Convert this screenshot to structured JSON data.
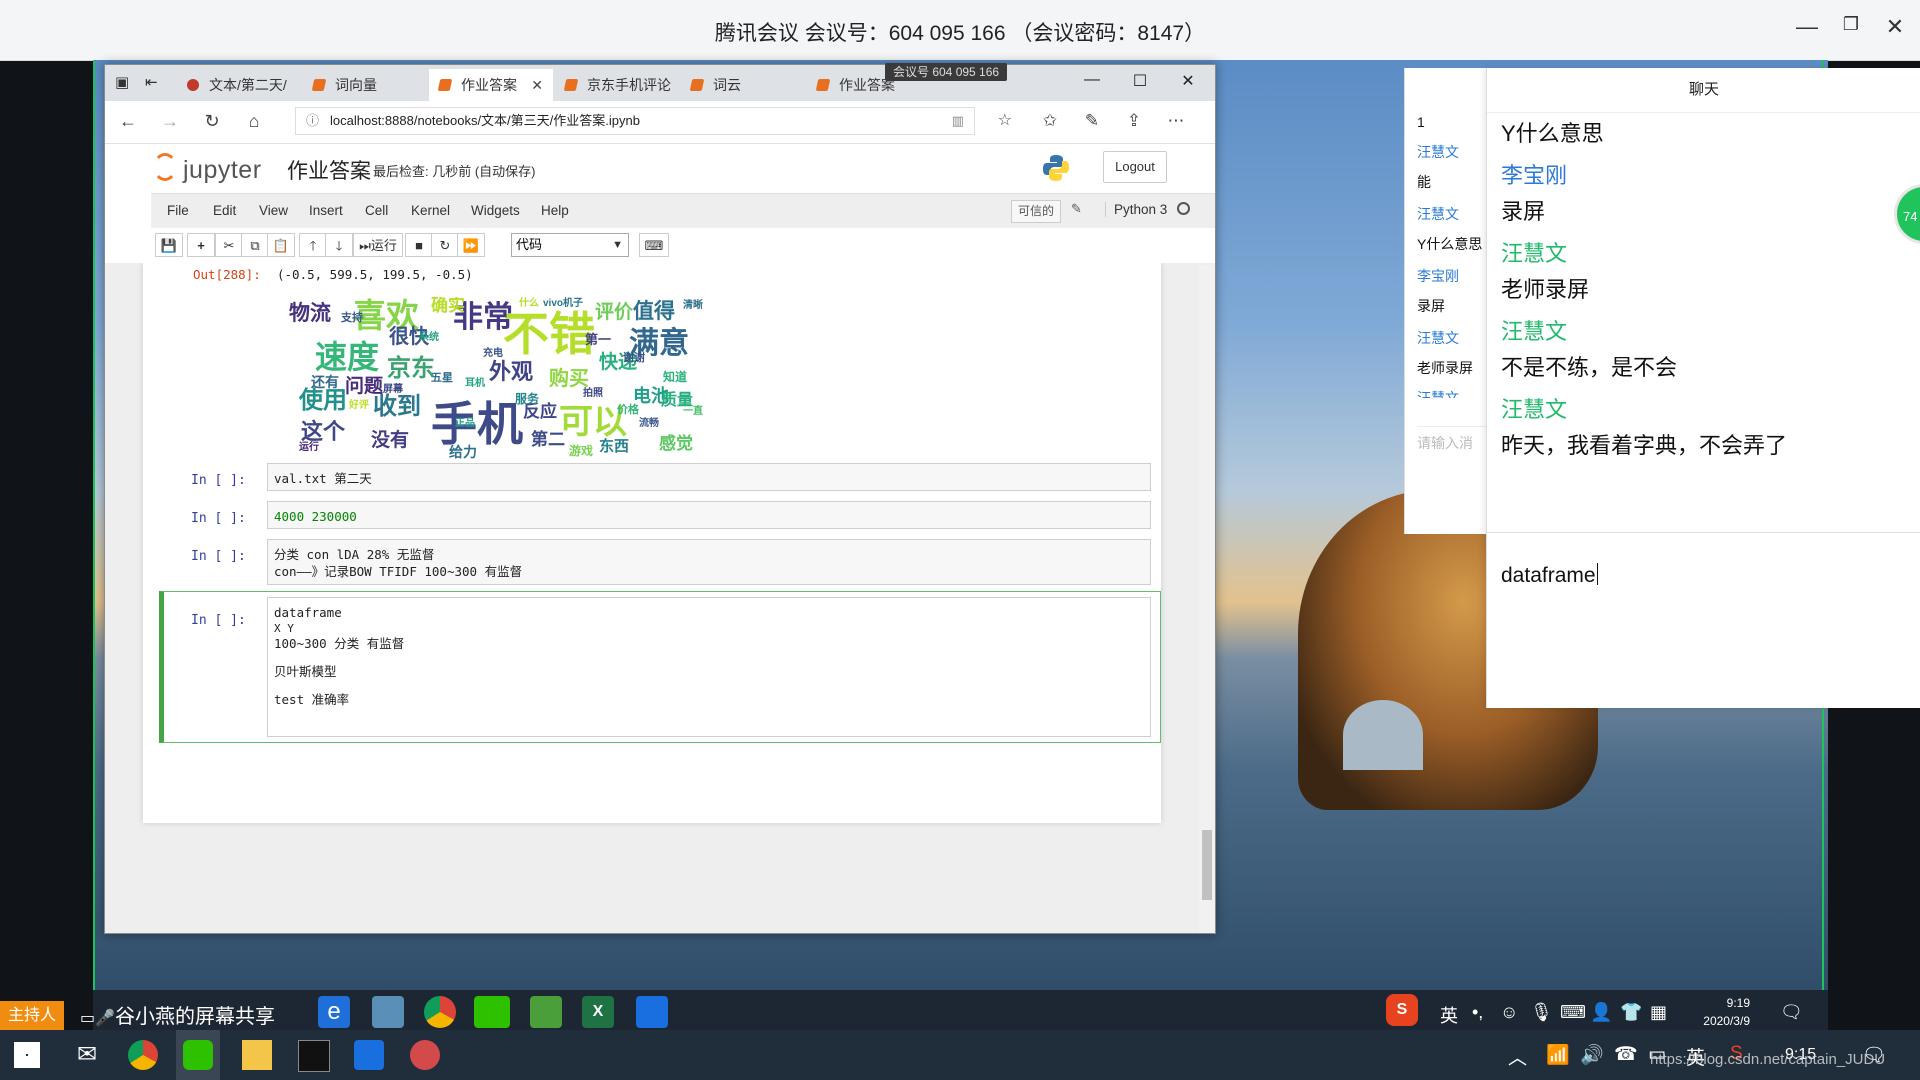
{
  "meeting": {
    "title": "腾讯会议 会议号：604 095 166 （会议密码：8147）",
    "minimize": "—",
    "restore": "❐",
    "close": "✕"
  },
  "browser": {
    "tabs": [
      {
        "label": "文本/第二天/"
      },
      {
        "label": "词向量"
      },
      {
        "label": "作业答案",
        "active": true,
        "close": "✕"
      },
      {
        "label": "京东手机评论"
      },
      {
        "label": "词云"
      },
      {
        "label": "作业答案"
      }
    ],
    "meeting_badge": "会议号 604 095 166",
    "url": "localhost:8888/notebooks/文本/第三天/作业答案.ipynb",
    "nav": {
      "back": "←",
      "forward": "→",
      "reload": "↻",
      "home": "⌂"
    },
    "info_icon": "ⓘ",
    "window_controls": {
      "minimize": "—",
      "maximize": "☐",
      "close": "✕"
    }
  },
  "jupyter": {
    "logo_text": "jupyter",
    "notebook_name": "作业答案",
    "save_status": "最后检查: 几秒前  (自动保存)",
    "logout": "Logout",
    "menu": [
      "File",
      "Edit",
      "View",
      "Insert",
      "Cell",
      "Kernel",
      "Widgets",
      "Help"
    ],
    "trusted": "可信的",
    "kernel": "Python 3",
    "run_label": "运行",
    "cell_type": "代码"
  },
  "notebook": {
    "out_prompt": "Out[288]:",
    "out_value": "(-0.5, 599.5, 199.5, -0.5)",
    "wordcloud_words": [
      "手机",
      "不错",
      "可以",
      "喜欢",
      "速度",
      "满意",
      "非常",
      "京东",
      "外观",
      "收到",
      "使用",
      "问题",
      "物流",
      "很快",
      "值得",
      "评价",
      "快递",
      "反应",
      "没有",
      "这个",
      "购买",
      "第二",
      "感觉",
      "电池",
      "质量",
      "确实",
      "东西",
      "游戏",
      "还有",
      "给力",
      "服务",
      "价格",
      "充电",
      "耳机",
      "系统",
      "支持",
      "运行",
      "好评",
      "屏幕",
      "流畅",
      "五星",
      "什么",
      "vivo机子",
      "正品",
      "第一",
      "谢谢",
      "知道",
      "一直",
      "拍照",
      "清晰"
    ],
    "cells": [
      {
        "prompt": "In [ ]:",
        "lines": [
          "val.txt 第二天"
        ]
      },
      {
        "prompt": "In [ ]:",
        "lines": [
          "4000     230000"
        ]
      },
      {
        "prompt": "In [ ]:",
        "lines": [
          "分类    con  lDA      28%      无监督",
          "con——》记录BOW TFIDF 100~300    有监督"
        ]
      },
      {
        "prompt": "In [ ]:",
        "lines": [
          "dataframe",
          "X          Y",
          "100~300   分类      有监督",
          "",
          "贝叶斯模型",
          "",
          "test  准确率"
        ]
      }
    ]
  },
  "chat_mini": {
    "items": [
      "1",
      "汪慧文",
      "能",
      "汪慧文",
      "Y什么意思",
      "李宝刚",
      "录屏",
      "汪慧文",
      "老师录屏",
      "汪慧文"
    ],
    "input_placeholder": "请输入消"
  },
  "chat": {
    "title": "聊天",
    "messages": [
      {
        "text": "Y什么意思"
      },
      {
        "name": "李宝刚",
        "text": "录屏",
        "color": "#2b7bd6"
      },
      {
        "name": "汪慧文",
        "text": "老师录屏",
        "color": "#1fba6a"
      },
      {
        "name": "汪慧文",
        "text": "不是不练，是不会",
        "color": "#1fba6a"
      },
      {
        "name": "汪慧文",
        "text": "昨天，我看着字典，不会弄了",
        "color": "#1fba6a"
      }
    ],
    "input_value": "dataframe",
    "bubble_count": "74"
  },
  "inner_taskbar": {
    "host_badge": "主持人",
    "sharer": "谷小燕的屏幕共享",
    "ime": "英",
    "time": "9:19",
    "date": "2020/3/9"
  },
  "taskbar": {
    "ime": "英",
    "time": "9:15",
    "watermark": "https://blog.csdn.net/captain_JUDU"
  }
}
